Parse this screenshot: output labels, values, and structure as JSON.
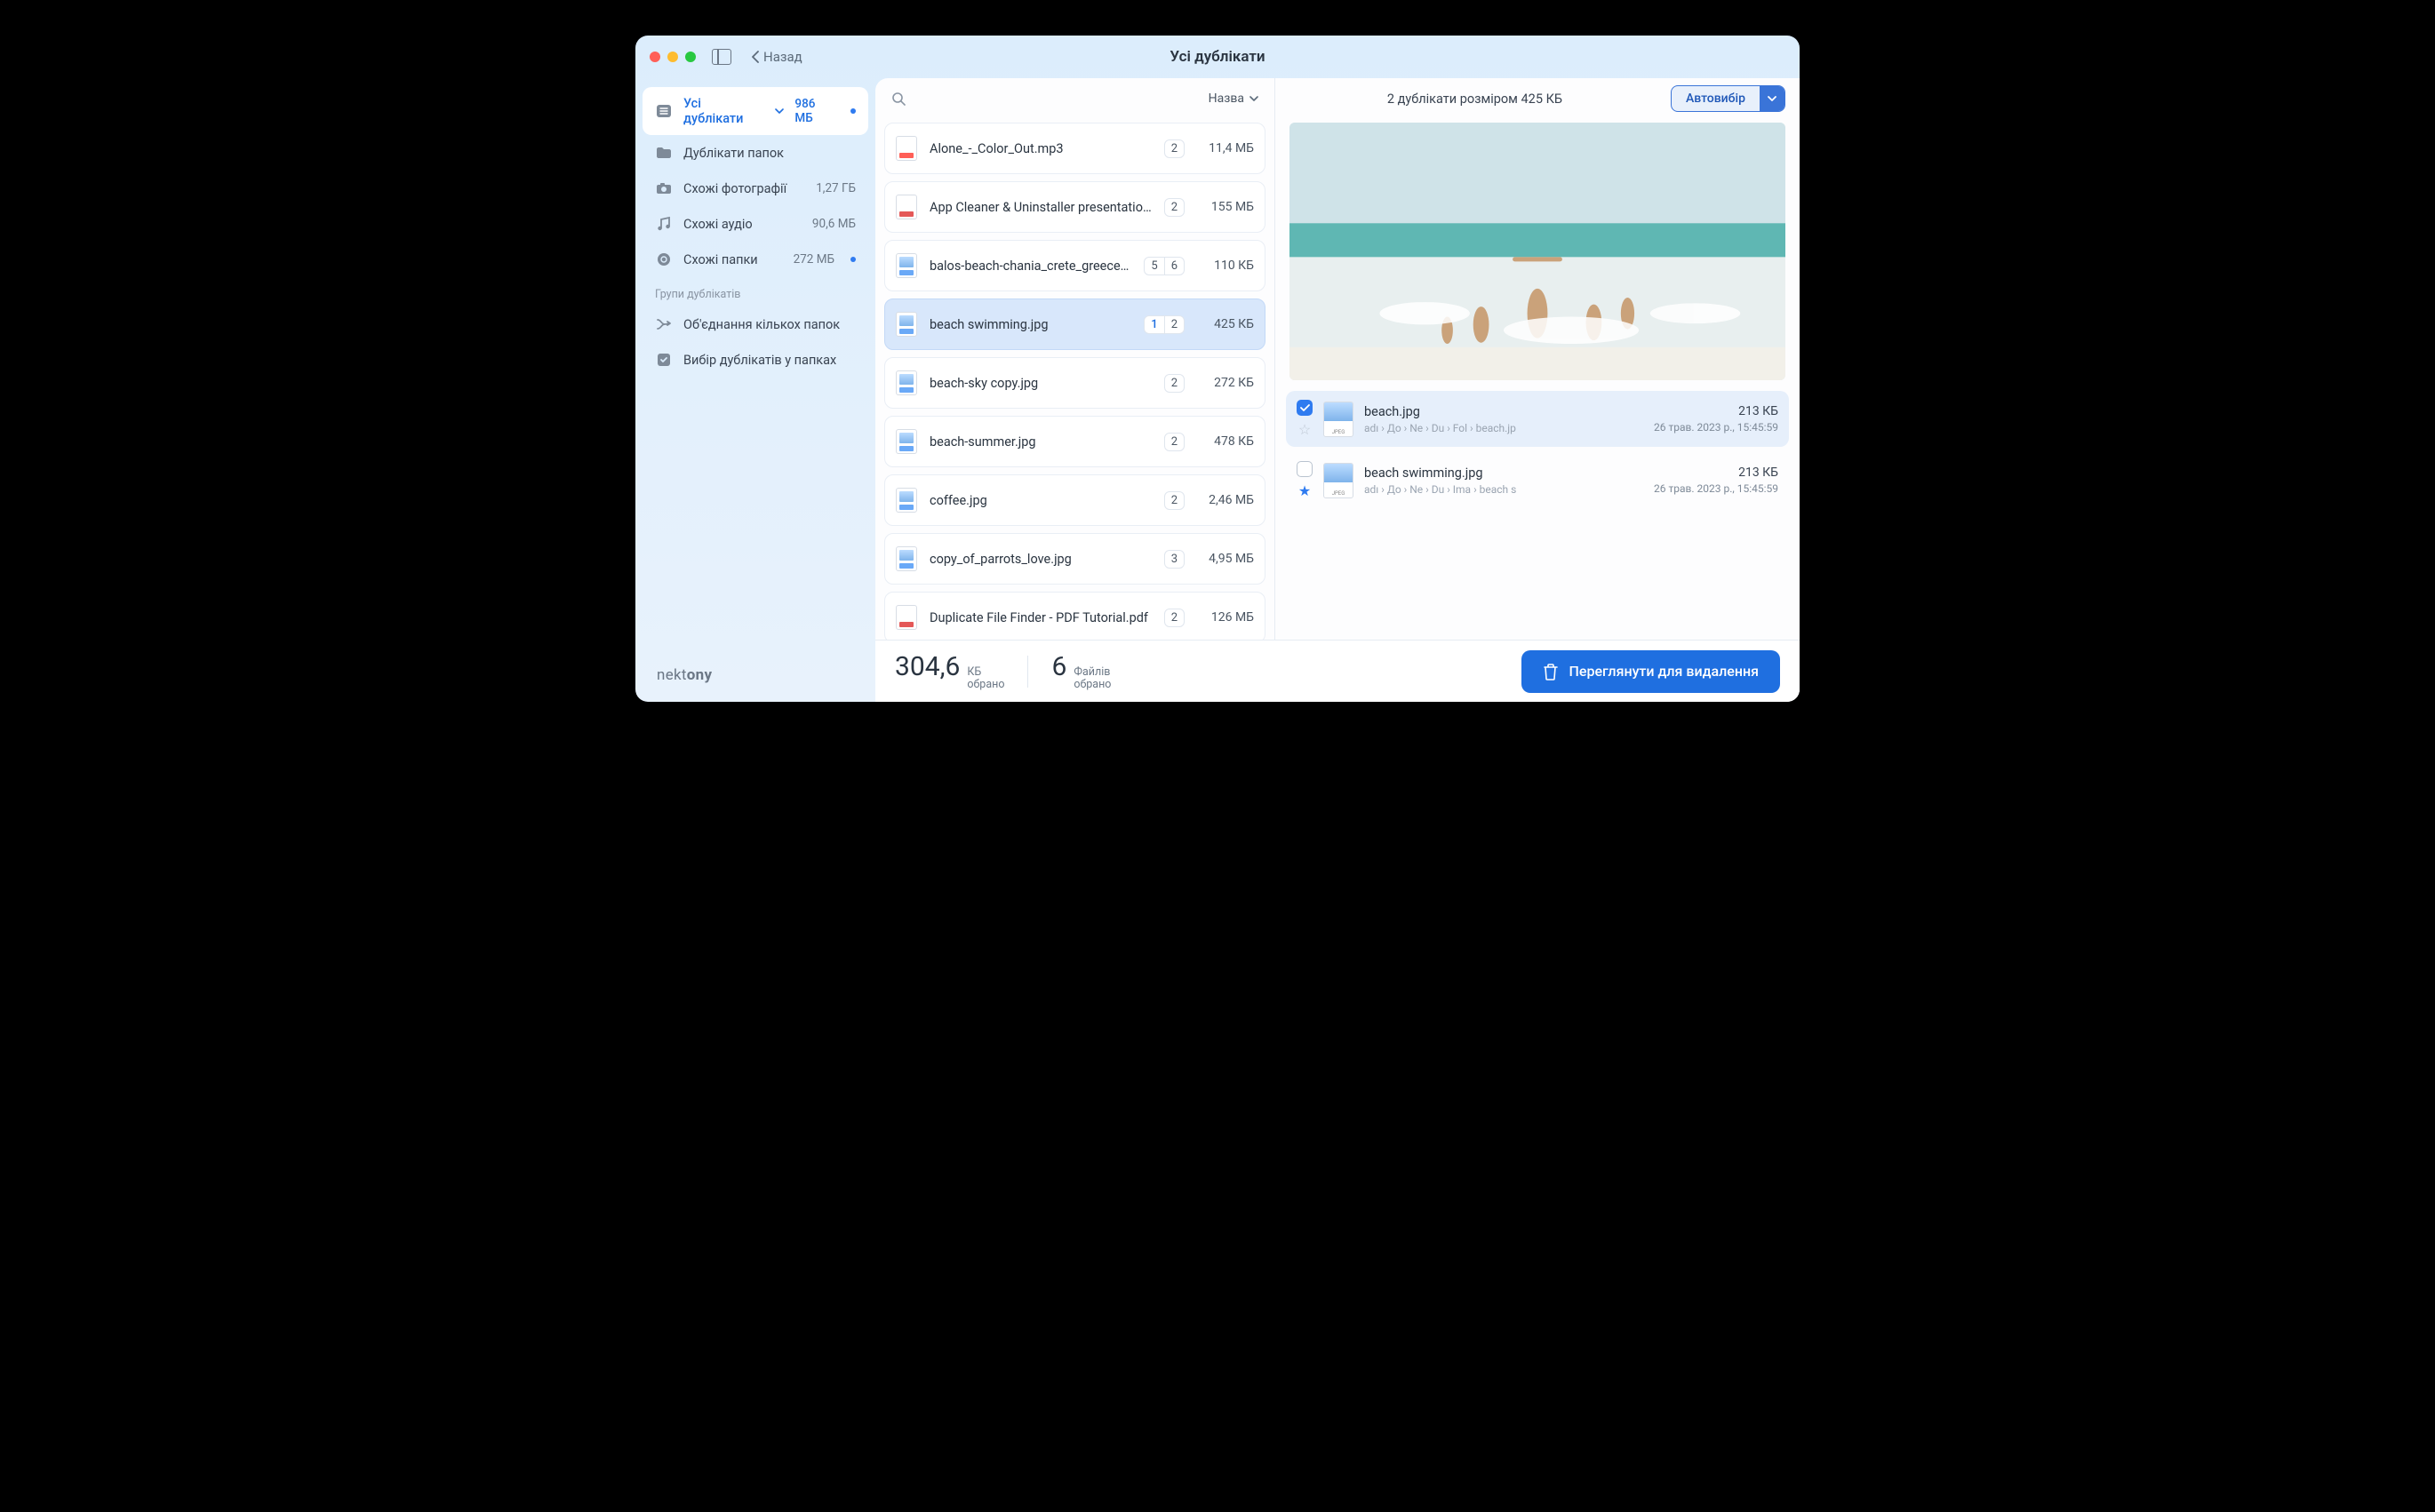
{
  "titlebar": {
    "back": "Назад",
    "title": "Усі дублікати"
  },
  "sidebar": {
    "items": [
      {
        "label": "Усі дублікати",
        "size": "986 МБ",
        "active": true,
        "dot": true,
        "chev": true,
        "icon": "list"
      },
      {
        "label": "Дублікати папок",
        "size": "",
        "icon": "folder"
      },
      {
        "label": "Схожі фотографії",
        "size": "1,27 ГБ",
        "icon": "camera"
      },
      {
        "label": "Схожі аудіо",
        "size": "90,6 МБ",
        "icon": "music"
      },
      {
        "label": "Схожі папки",
        "size": "272 МБ",
        "dot": true,
        "icon": "link"
      }
    ],
    "group_label": "Групи дублікатів",
    "groups": [
      {
        "label": "Об'єднання кількох папок",
        "icon": "merge"
      },
      {
        "label": "Вибір дублікатів у папках",
        "icon": "check"
      }
    ],
    "brand_a": "nekt",
    "brand_b": "ony"
  },
  "list": {
    "sort": "Назва",
    "rows": [
      {
        "name": "Alone_-_Color_Out.mp3",
        "badges": [
          "2"
        ],
        "size": "11,4 МБ",
        "type": "mp3"
      },
      {
        "name": "App Cleaner & Uninstaller presentation...",
        "badges": [
          "2"
        ],
        "size": "155 МБ",
        "type": "pdf"
      },
      {
        "name": "balos-beach-chania_crete_greece.j...",
        "badges": [
          "5",
          "6"
        ],
        "size": "110 КБ",
        "type": "jpeg"
      },
      {
        "name": "beach swimming.jpg",
        "badges": [
          "1",
          "2"
        ],
        "size": "425 КБ",
        "type": "jpeg",
        "selected": true,
        "blue": 0
      },
      {
        "name": "beach-sky copy.jpg",
        "badges": [
          "2"
        ],
        "size": "272 КБ",
        "type": "jpeg"
      },
      {
        "name": "beach-summer.jpg",
        "badges": [
          "2"
        ],
        "size": "478 КБ",
        "type": "jpeg"
      },
      {
        "name": "coffee.jpg",
        "badges": [
          "2"
        ],
        "size": "2,46 МБ",
        "type": "jpeg"
      },
      {
        "name": "copy_of_parrots_love.jpg",
        "badges": [
          "3"
        ],
        "size": "4,95 МБ",
        "type": "jpeg"
      },
      {
        "name": "Duplicate File Finder -  PDF Tutorial.pdf",
        "badges": [
          "2"
        ],
        "size": "126 МБ",
        "type": "pdf"
      }
    ]
  },
  "preview": {
    "info": "2 дублікати розміром 425 КБ",
    "auto": "Автовибір",
    "dups": [
      {
        "name": "beach.jpg",
        "path": "adı › До › Ne › Du › Fol › beach.jp",
        "size": "213 КБ",
        "date": "26 трав. 2023 р., 15:45:59",
        "checked": true,
        "star": false,
        "sel": true
      },
      {
        "name": "beach swimming.jpg",
        "path": "adı › До › Ne › Du › Ima › beach s",
        "size": "213 КБ",
        "date": "26 трав. 2023 р., 15:45:59",
        "checked": false,
        "star": true,
        "sel": false
      }
    ]
  },
  "footer": {
    "size_num": "304,6",
    "size_unit": "КБ",
    "size_label": "обрано",
    "files_num": "6",
    "files_unit": "Файлів",
    "files_label": "обрано",
    "review": "Переглянути для видалення"
  }
}
